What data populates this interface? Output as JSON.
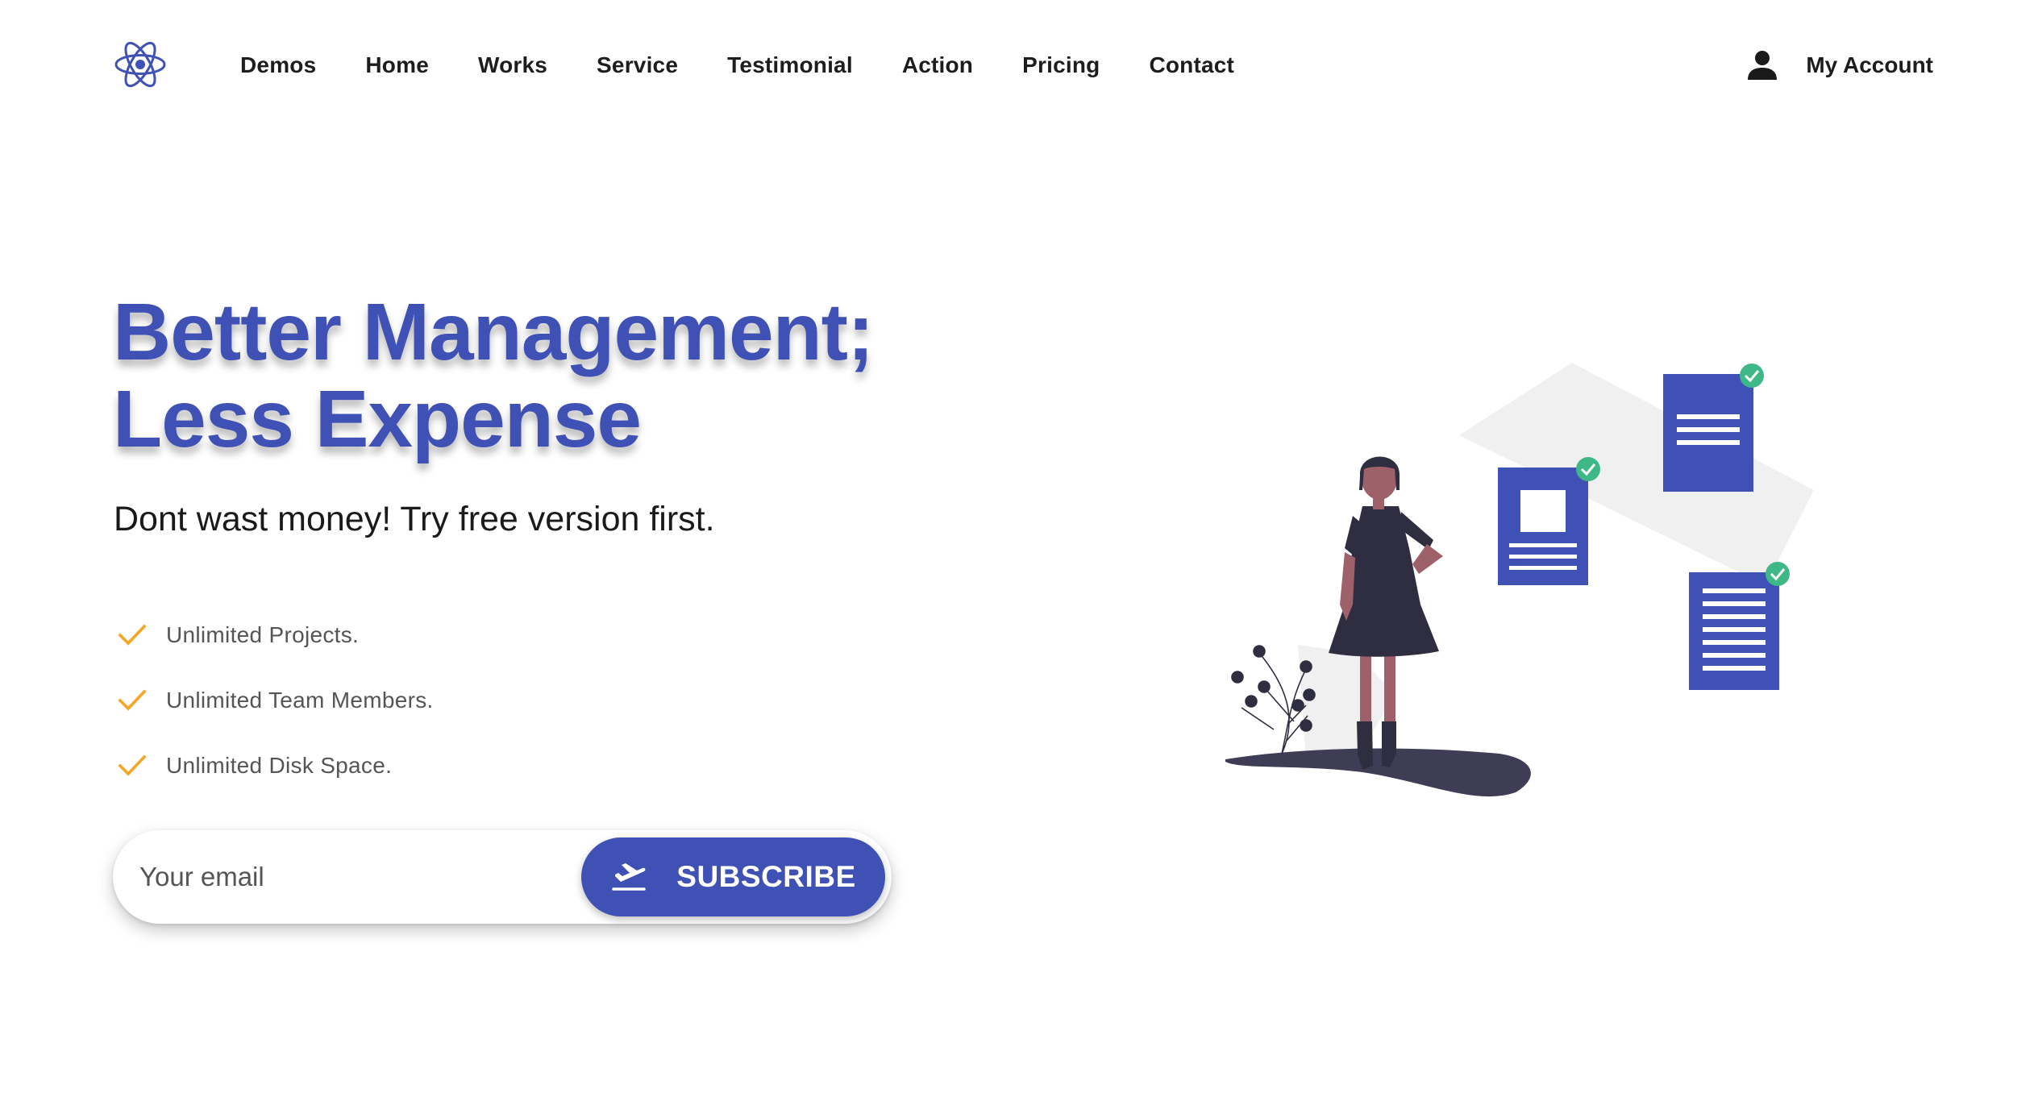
{
  "header": {
    "logo_icon": "react-atom-icon",
    "nav": [
      {
        "label": "Demos"
      },
      {
        "label": "Home"
      },
      {
        "label": "Works"
      },
      {
        "label": "Service"
      },
      {
        "label": "Testimonial"
      },
      {
        "label": "Action"
      },
      {
        "label": "Pricing"
      },
      {
        "label": "Contact"
      }
    ],
    "account": {
      "icon": "user-icon",
      "label": "My Account"
    }
  },
  "hero": {
    "title_line1": "Better Management;",
    "title_line2": "Less Expense",
    "subtitle": "Dont wast money! Try free version first.",
    "features": [
      {
        "icon": "check-icon",
        "text": "Unlimited Projects."
      },
      {
        "icon": "check-icon",
        "text": "Unlimited Team Members."
      },
      {
        "icon": "check-icon",
        "text": "Unlimited Disk Space."
      }
    ]
  },
  "subscribe": {
    "email_placeholder": "Your email",
    "email_value": "",
    "button_icon": "airplane-takeoff-icon",
    "button_label": "SUBSCRIBE"
  },
  "colors": {
    "primary": "#3f51b5",
    "check": "#f5a623",
    "success": "#3fb887",
    "figure_dark": "#2f2e41",
    "skin": "#9e616a",
    "backdrop": "#f0f0f0"
  }
}
